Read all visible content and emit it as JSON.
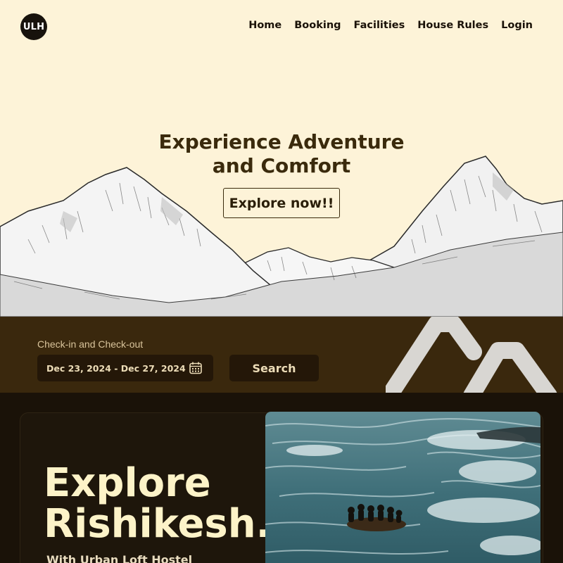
{
  "brand": {
    "logo_text": "ULH"
  },
  "nav": {
    "items": [
      {
        "label": "Home"
      },
      {
        "label": "Booking"
      },
      {
        "label": "Facilities"
      },
      {
        "label": "House Rules"
      },
      {
        "label": "Login"
      }
    ]
  },
  "hero": {
    "title_line1": "Experience Adventure",
    "title_line2": "and Comfort",
    "cta_label": "Explore now!!"
  },
  "booking": {
    "label": "Check-in and Check-out",
    "date_range": "Dec 23, 2024 - Dec 27, 2024",
    "search_label": "Search",
    "icon": "calendar-icon"
  },
  "explore": {
    "title_line1": "Explore",
    "title_line2": "Rishikesh.",
    "subtitle": "With Urban Loft Hostel"
  },
  "colors": {
    "hero_bg": "#fdf3d8",
    "booking_bg": "#3a280d",
    "section_bg": "#1a1208",
    "accent_text": "#fdf3c8"
  }
}
